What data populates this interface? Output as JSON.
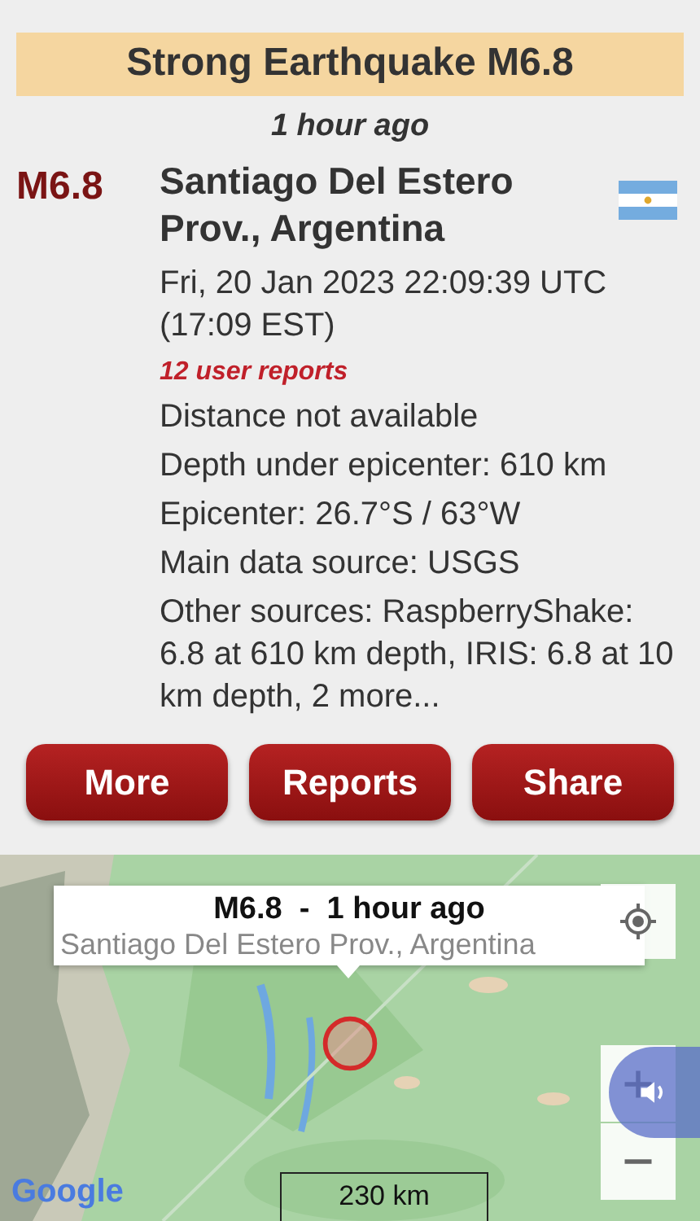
{
  "banner": {
    "title": "Strong Earthquake M6.8"
  },
  "time_ago": "1 hour ago",
  "quake": {
    "magnitude": "M6.8",
    "place": "Santiago Del Estero Prov., Argentina",
    "datetime": "Fri, 20 Jan 2023 22:09:39 UTC (17:09 EST)",
    "user_reports": "12 user reports",
    "details": [
      "Distance not available",
      "Depth under epicenter: 610 km",
      "Epicenter: 26.7°S / 63°W",
      "Main data source: USGS",
      "Other sources: RaspberryShake: 6.8 at 610 km depth, IRIS: 6.8 at 10 km depth, 2 more..."
    ]
  },
  "buttons": [
    "More",
    "Reports",
    "Share"
  ],
  "map": {
    "info_window": {
      "title": "M6.8  -  1 hour ago",
      "subtitle": "Santiago Del Estero Prov., Argentina"
    },
    "logo": "Google",
    "scale": "230 km"
  }
}
